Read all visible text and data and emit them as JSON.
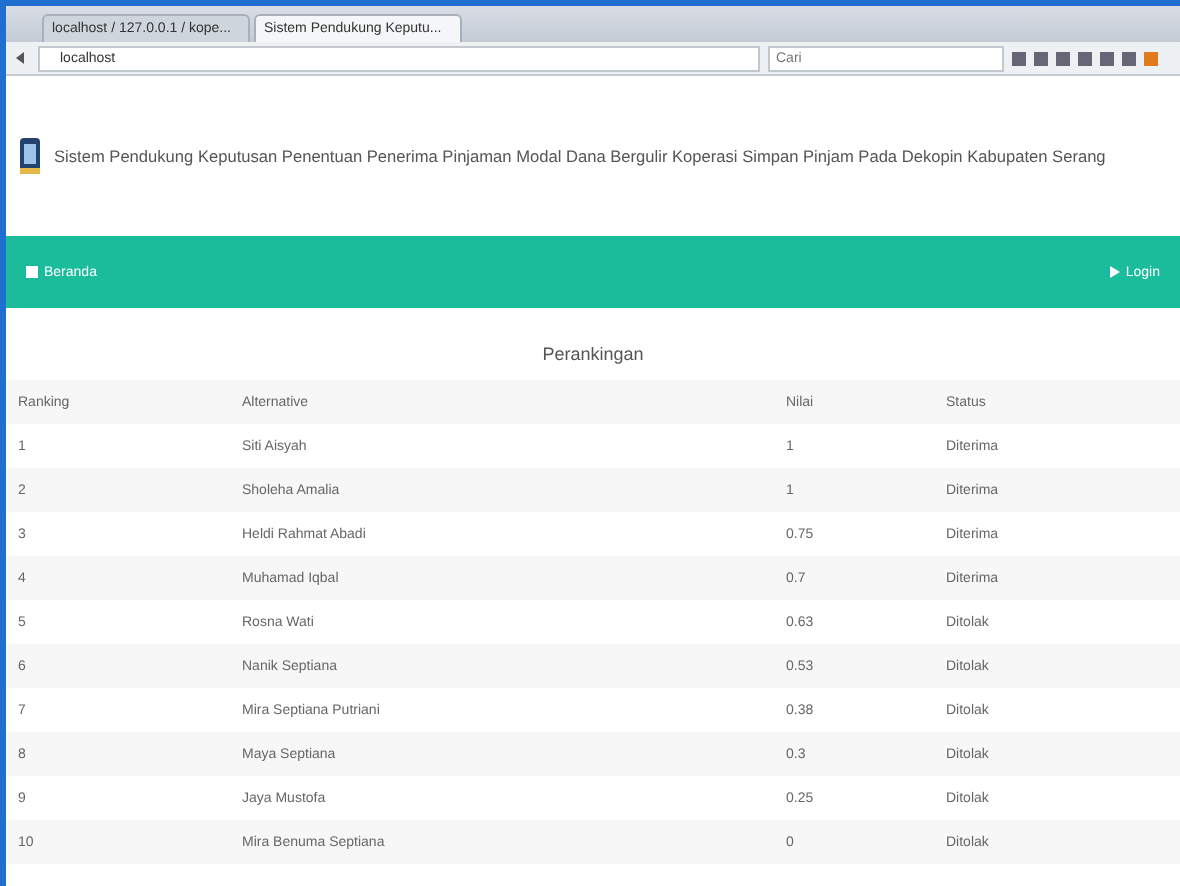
{
  "browser": {
    "tabs": [
      {
        "label": "localhost / 127.0.0.1 / kope...",
        "selected": false
      },
      {
        "label": "Sistem Pendukung Keputu...",
        "selected": true
      }
    ],
    "address": "localhost",
    "search_placeholder": "Cari"
  },
  "header": {
    "title": "Sistem Pendukung Keputusan Penentuan Penerima Pinjaman Modal Dana Bergulir Koperasi Simpan Pinjam Pada Dekopin Kabupaten Serang"
  },
  "nav": {
    "home": "Beranda",
    "login": "Login"
  },
  "table": {
    "caption": "Perankingan",
    "columns": [
      "Ranking",
      "Alternative",
      "Nilai",
      "Status"
    ],
    "rows": [
      [
        "1",
        "Siti Aisyah",
        "1",
        "Diterima"
      ],
      [
        "2",
        "Sholeha Amalia",
        "1",
        "Diterima"
      ],
      [
        "3",
        "Heldi Rahmat Abadi",
        "0.75",
        "Diterima"
      ],
      [
        "4",
        "Muhamad Iqbal",
        "0.7",
        "Diterima"
      ],
      [
        "5",
        "Rosna Wati",
        "0.63",
        "Ditolak"
      ],
      [
        "6",
        "Nanik Septiana",
        "0.53",
        "Ditolak"
      ],
      [
        "7",
        "Mira Septiana Putriani",
        "0.38",
        "Ditolak"
      ],
      [
        "8",
        "Maya Septiana",
        "0.3",
        "Ditolak"
      ],
      [
        "9",
        "Jaya Mustofa",
        "0.25",
        "Ditolak"
      ],
      [
        "10",
        "Mira Benuma Septiana",
        "0",
        "Ditolak"
      ]
    ]
  }
}
